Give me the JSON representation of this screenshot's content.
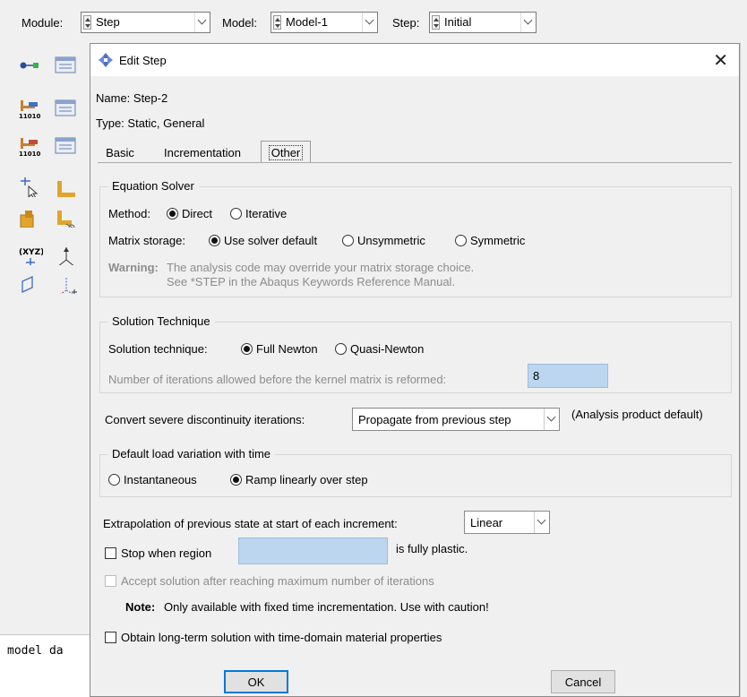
{
  "topbar": {
    "module_label": "Module:",
    "module_value": "Step",
    "model_label": "Model:",
    "model_value": "Model-1",
    "step_label": "Step:",
    "step_value": "Initial"
  },
  "message_area": {
    "text": "model da"
  },
  "dialog": {
    "title": "Edit Step",
    "close_glyph": "✕",
    "name": "Name: Step-2",
    "type": "Type: Static, General",
    "tabs": [
      {
        "label": "Basic"
      },
      {
        "label": "Incrementation"
      },
      {
        "label": "Other"
      }
    ],
    "equation_solver": {
      "legend": "Equation Solver",
      "method_label": "Method:",
      "method_direct": "Direct",
      "method_iterative": "Iterative",
      "matrix_label": "Matrix storage:",
      "matrix_default": "Use solver default",
      "matrix_unsym": "Unsymmetric",
      "matrix_sym": "Symmetric",
      "warning_label": "Warning:",
      "warning_line1": "The analysis code may override your matrix storage choice.",
      "warning_line2": "See *STEP in the Abaqus Keywords Reference Manual."
    },
    "solution_technique": {
      "legend": "Solution Technique",
      "label": "Solution technique:",
      "full_newton": "Full Newton",
      "quasi_newton": "Quasi-Newton",
      "iterations_label": "Number of iterations allowed before the kernel matrix is reformed:",
      "iterations_value": "8"
    },
    "discontinuity": {
      "label": "Convert severe discontinuity iterations:",
      "value": "Propagate from previous step",
      "note": "(Analysis product default)"
    },
    "load_variation": {
      "legend": "Default load variation with time",
      "instantaneous": "Instantaneous",
      "ramp": "Ramp linearly over step"
    },
    "extrapolation": {
      "label": "Extrapolation of previous state at start of each increment:",
      "value": "Linear"
    },
    "stop_region": {
      "label": "Stop when region",
      "suffix": "is fully plastic.",
      "value": ""
    },
    "accept_solution": "Accept solution after reaching maximum number of iterations",
    "note_label": "Note:",
    "note_text": "Only available with fixed time incrementation. Use with caution!",
    "long_term": "Obtain long-term solution with time-domain material properties",
    "ok_label": "OK",
    "cancel_label": "Cancel"
  }
}
